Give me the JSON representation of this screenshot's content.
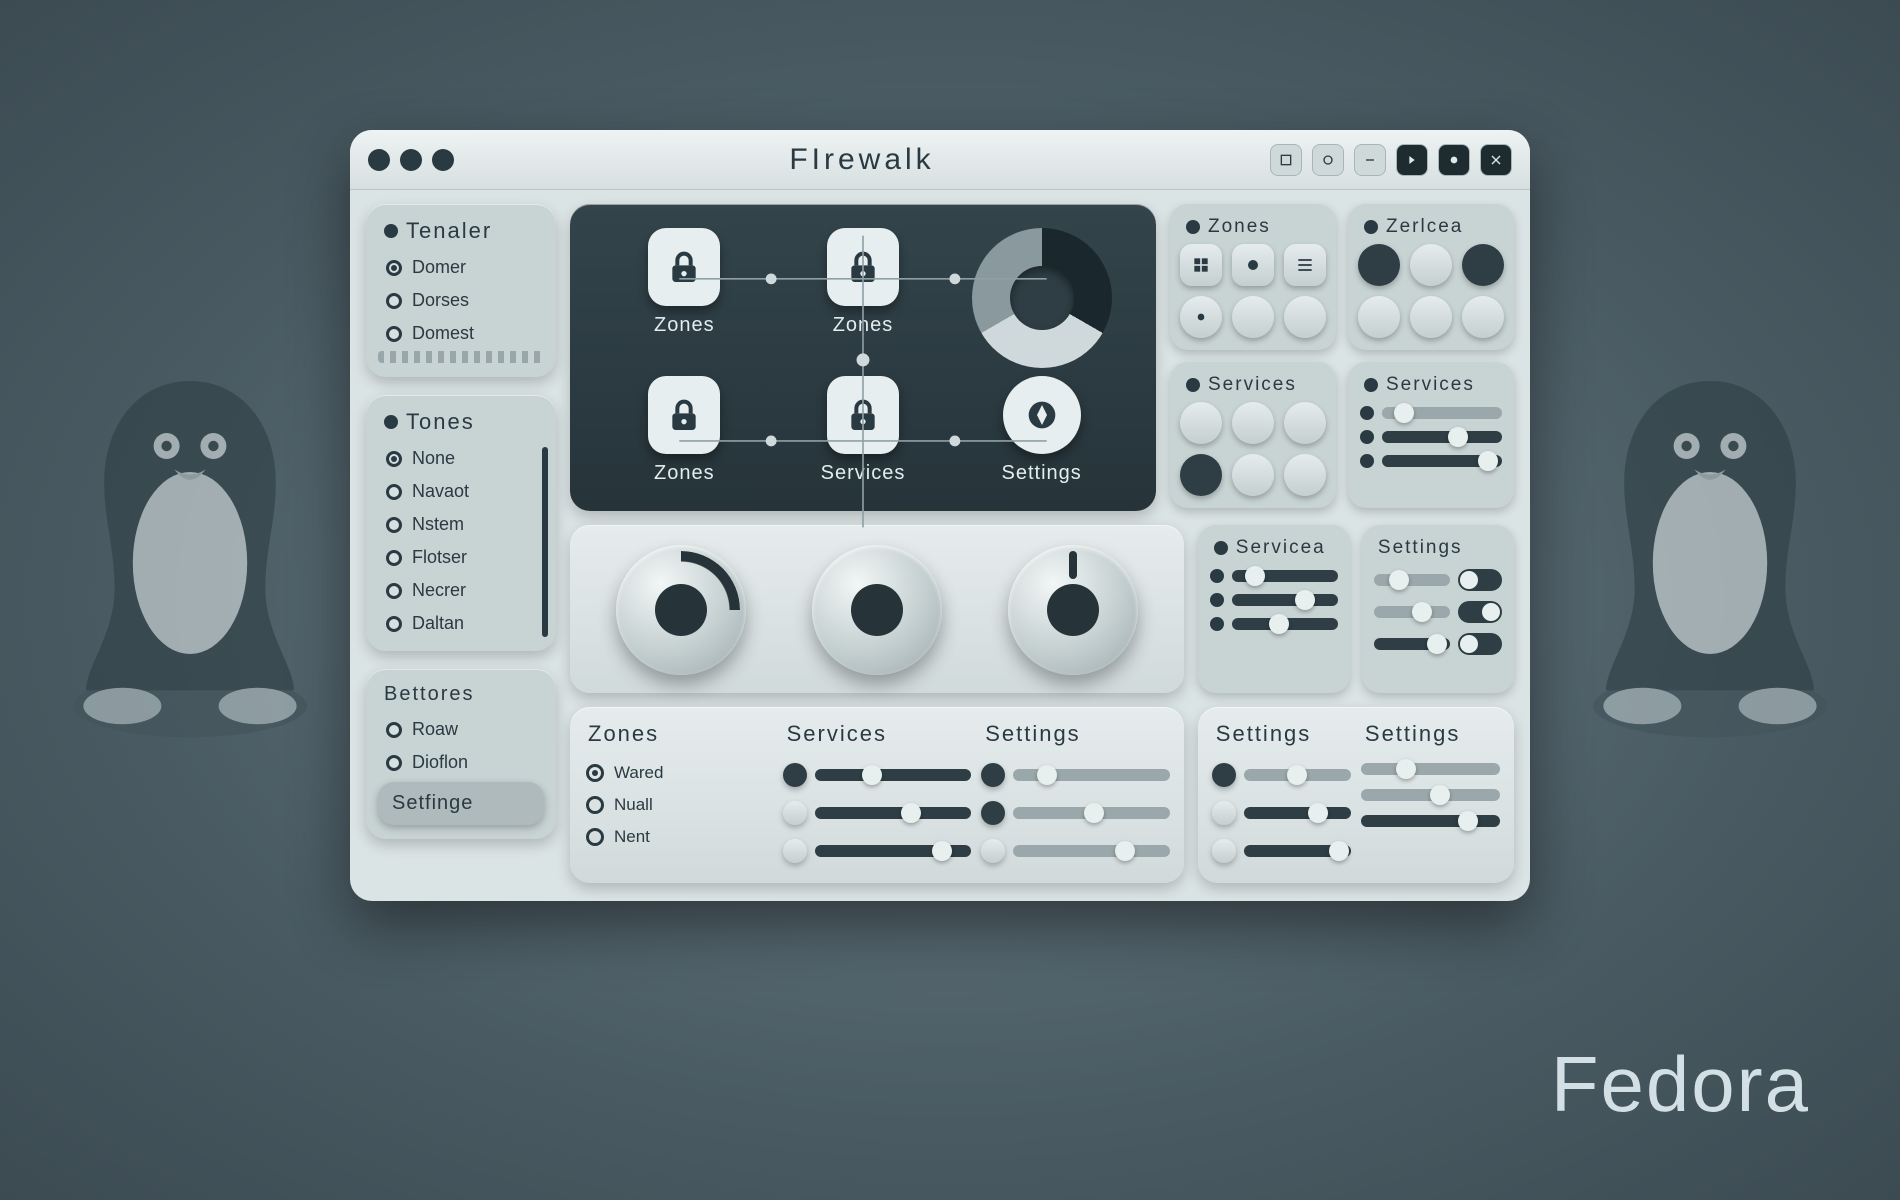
{
  "brand": "Fedora",
  "window": {
    "title": "FIrewalk"
  },
  "sidebar": {
    "panel1": {
      "title": "Tenaler",
      "items": [
        "Domer",
        "Dorses",
        "Domest"
      ]
    },
    "panel2": {
      "title": "Tones",
      "items": [
        "None",
        "Navaot",
        "Nstem",
        "Flotser",
        "Necrer",
        "Daltan"
      ]
    },
    "panel3": {
      "title": "Bettores",
      "items": [
        "Roaw",
        "Dioflon"
      ],
      "button": "Setfinge"
    }
  },
  "darkgrid": {
    "cells": [
      {
        "label": "Zones"
      },
      {
        "label": "Zones"
      },
      {
        "label": ""
      },
      {
        "label": "Zones"
      },
      {
        "label": "Services"
      },
      {
        "label": "Settings"
      }
    ]
  },
  "miniA": {
    "title": "Zones"
  },
  "miniB": {
    "title": "Zerlcea"
  },
  "miniC": {
    "title": "Services"
  },
  "miniD": {
    "title": "Services"
  },
  "miniE": {
    "title": "Servicea"
  },
  "miniF": {
    "title": "Settings"
  },
  "bottom": {
    "colA": {
      "title": "Zones",
      "items": [
        "Wared",
        "Nuall",
        "Nent"
      ]
    },
    "colB": {
      "title": "Services"
    },
    "colC": {
      "title": "Settings"
    }
  },
  "bottomR": {
    "colA": {
      "title": "Settings"
    },
    "colB": {
      "title": "Settings"
    }
  }
}
